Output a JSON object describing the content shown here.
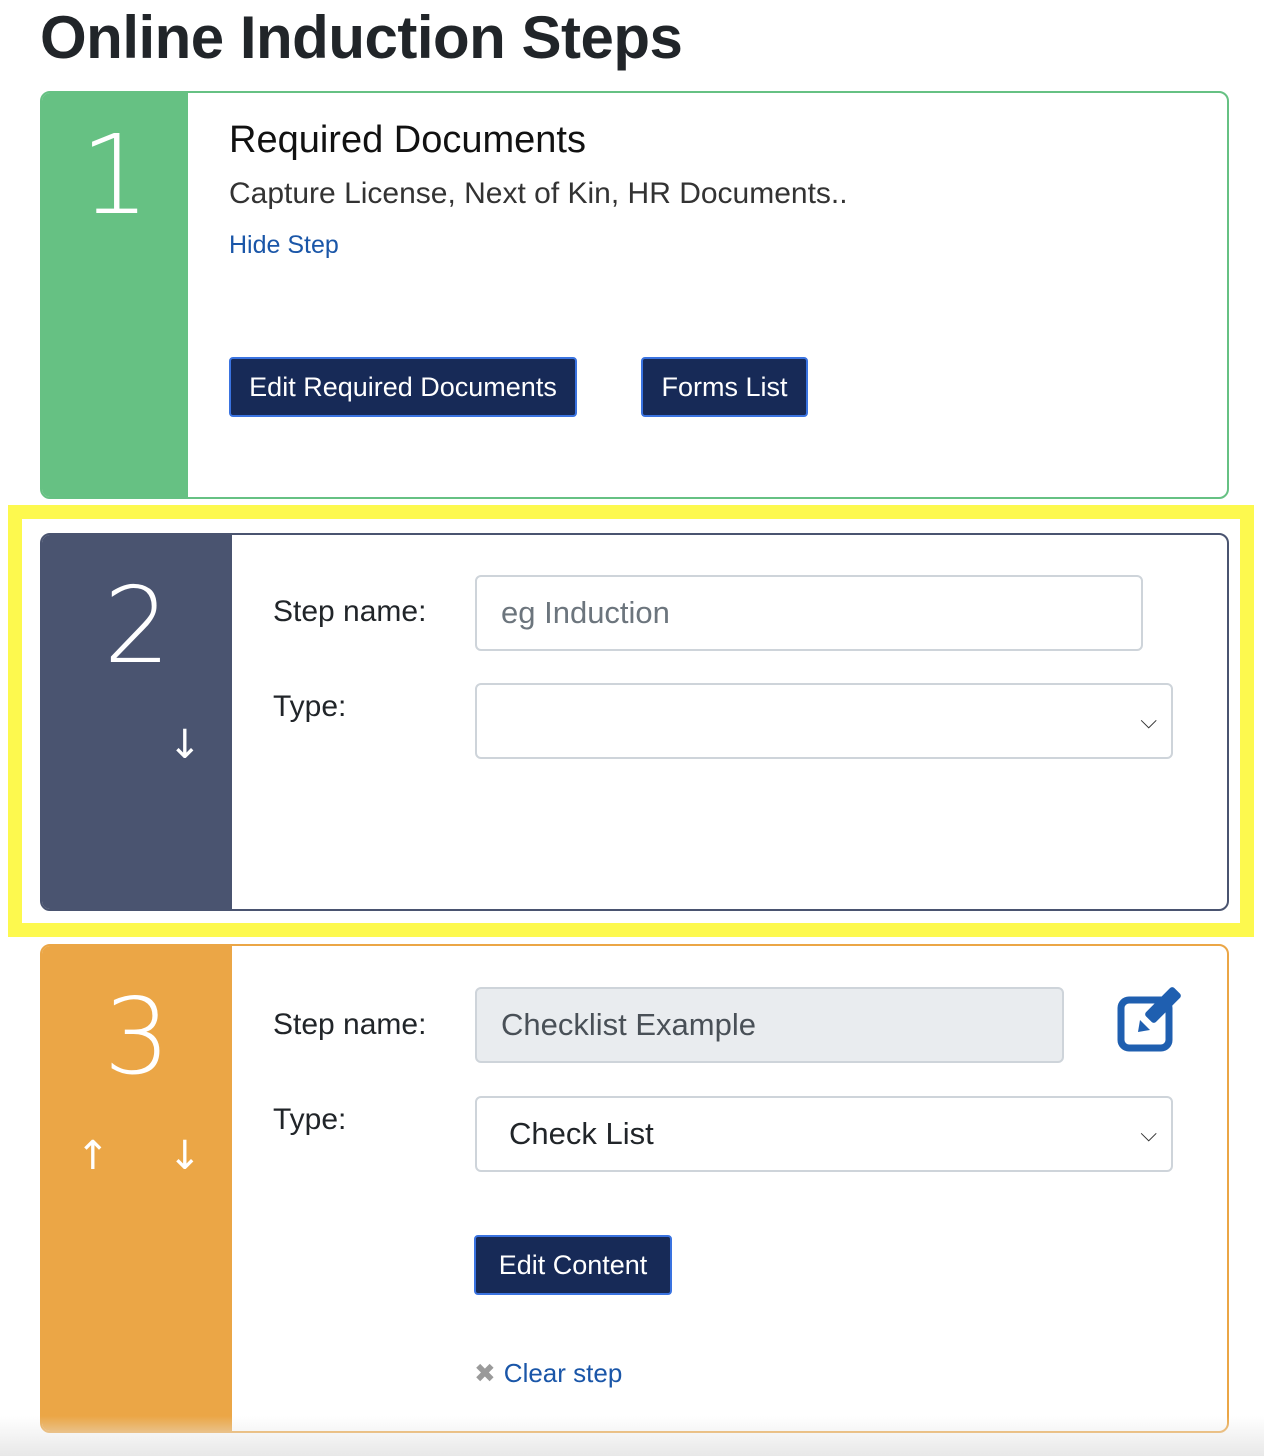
{
  "page": {
    "title": "Online Induction Steps"
  },
  "steps": [
    {
      "number": "1",
      "title": "Required Documents",
      "description": "Capture License, Next of Kin, HR Documents..",
      "hide_link": "Hide Step",
      "buttons": {
        "edit_docs": "Edit Required Documents",
        "forms_list": "Forms List"
      },
      "color": "#66c183"
    },
    {
      "number": "2",
      "name_label": "Step name:",
      "name_placeholder": "eg Induction",
      "name_value": "",
      "type_label": "Type:",
      "type_value": "",
      "move_down": "↓",
      "color": "#4a5470",
      "highlight_color": "#fdf94e"
    },
    {
      "number": "3",
      "name_label": "Step name:",
      "name_value": "Checklist Example",
      "type_label": "Type:",
      "type_value": "Check List",
      "edit_content_button": "Edit Content",
      "clear_step_link": "Clear step",
      "clear_icon": "✖",
      "move_up": "↑",
      "move_down": "↓",
      "edit_icon": "edit-icon",
      "color": "#eba646"
    }
  ],
  "chevron": "⌵"
}
